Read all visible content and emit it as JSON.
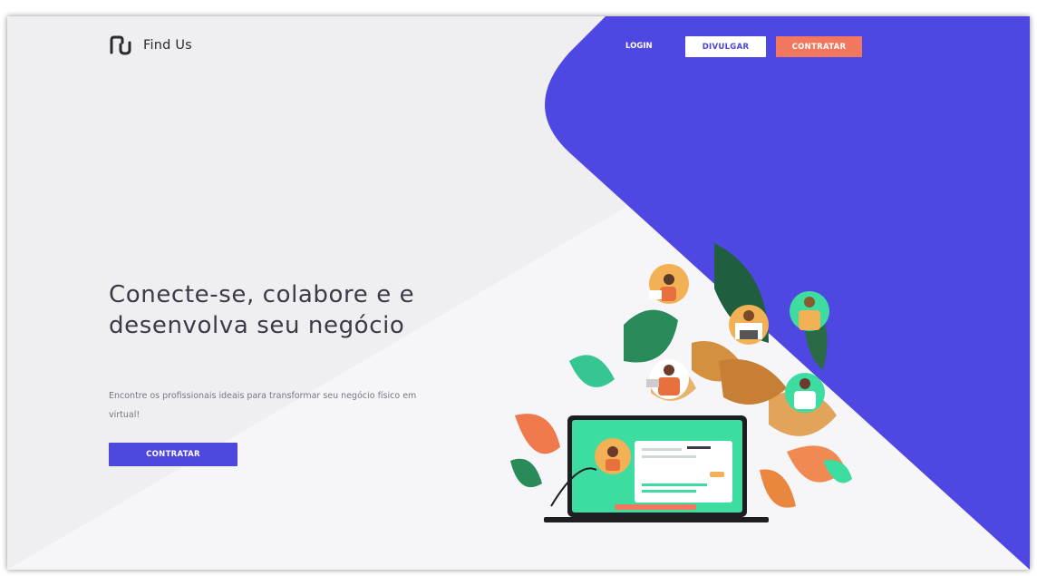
{
  "brand": {
    "name": "Find Us"
  },
  "nav": {
    "login": "LOGIN",
    "divulgar": "DIVULGAR",
    "contratar": "CONTRATAR"
  },
  "hero": {
    "title": "Conecte-se, colabore e e desenvolva seu negócio",
    "subtitle": "Encontre os profissionais ideais para transformar seu negócio físico em virtual!",
    "cta": "CONTRATAR"
  },
  "colors": {
    "accent_purple": "#4e47de",
    "accent_orange": "#f1785e",
    "background": "#efeff1",
    "illustration_green": "#3ddca0"
  },
  "icons": [
    "find-us-logo-icon"
  ]
}
